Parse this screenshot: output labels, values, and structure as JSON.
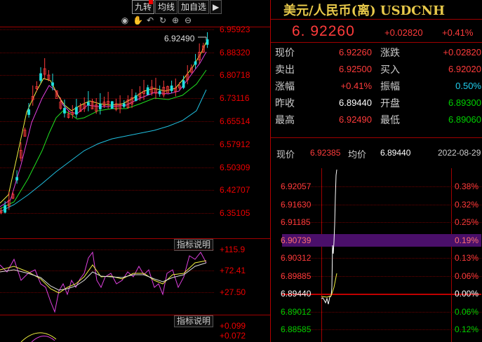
{
  "toolbar": {
    "btn1": "九转",
    "btn2": "均线",
    "btn3": "加自选",
    "btn4": "▶"
  },
  "main_chart": {
    "price_labels": [
      "6.95923",
      "6.88320",
      "6.80718",
      "6.73116",
      "6.65514",
      "6.57912",
      "6.50309",
      "6.42707",
      "6.35105"
    ],
    "high_marker": "6.92490"
  },
  "indicator1": {
    "label": "指标说明",
    "values": [
      "+115.9",
      "+72.41",
      "+27.50"
    ]
  },
  "indicator2": {
    "label": "指标说明",
    "values": [
      "+0.099",
      "+0.072"
    ]
  },
  "quote": {
    "title": "美元/人民币(离) USDCNH",
    "price": "6. 92260",
    "change": "+0.02820",
    "change_pct": "+0.41%",
    "rows": [
      {
        "l1": "现价",
        "v1": "6.92260",
        "c1": "red",
        "l2": "涨跌",
        "v2": "+0.02820",
        "c2": "red"
      },
      {
        "l1": "卖出",
        "v1": "6.92500",
        "c1": "red",
        "l2": "买入",
        "v2": "6.92020",
        "c2": "red"
      },
      {
        "l1": "涨幅",
        "v1": "+0.41%",
        "c1": "red",
        "l2": "振幅",
        "v2": "0.50%",
        "c2": "cyan"
      },
      {
        "l1": "昨收",
        "v1": "6.89440",
        "c1": "white",
        "l2": "开盘",
        "v2": "6.89300",
        "c2": "green"
      },
      {
        "l1": "最高",
        "v1": "6.92490",
        "c1": "red",
        "l2": "最低",
        "v2": "6.89060",
        "c2": "green"
      }
    ]
  },
  "intraday": {
    "now_label": "现价",
    "now_value": "6.92385",
    "avg_label": "均价",
    "avg_value": "6.89440",
    "date": "2022-08-29",
    "left_labels": [
      "6.92057",
      "6.91630",
      "6.91185",
      "6.90739",
      "6.90312",
      "6.89885",
      "6.89440",
      "6.89012",
      "6.88585"
    ],
    "right_labels": [
      "0.38%",
      "0.32%",
      "0.25%",
      "0.19%",
      "0.13%",
      "0.06%",
      "0.00%",
      "0.06%",
      "0.12%"
    ]
  },
  "colors": {
    "up": "#ff3b3b",
    "down": "#00d000",
    "grid": "#6b0000",
    "title": "#e8c94a",
    "highlight": "#6a1b9a"
  }
}
